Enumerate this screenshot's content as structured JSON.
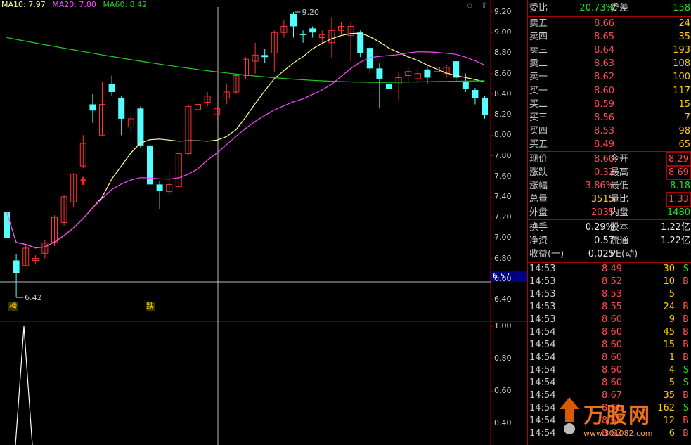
{
  "legend": {
    "ma10": "MA10: 7.97",
    "ma20": "MA20: 7.80",
    "ma60": "MA60: 8.42",
    "colors": {
      "ma10": "#ffff99",
      "ma20": "#ff44ff",
      "ma60": "#22cc22"
    }
  },
  "annotations": {
    "high_label": "9.20",
    "low_label": "6.42",
    "badge_bang": "榜",
    "badge_die": "跌",
    "current_tag": "6.57"
  },
  "price_axis": [
    "9.20",
    "9.00",
    "8.80",
    "8.60",
    "8.40",
    "8.20",
    "8.00",
    "7.80",
    "7.60",
    "7.40",
    "7.20",
    "7.00",
    "6.80",
    "6.60",
    "6.40"
  ],
  "indicator_axis": [
    "1.00",
    "0.80",
    "0.60",
    "0.40"
  ],
  "candles": [
    {
      "o": 7.0,
      "c": 7.25,
      "h": 7.25,
      "l": 7.0,
      "up": false
    },
    {
      "o": 6.78,
      "c": 6.66,
      "h": 6.84,
      "l": 6.42,
      "up": false
    },
    {
      "o": 6.73,
      "c": 6.9,
      "h": 6.93,
      "l": 6.72,
      "up": true
    },
    {
      "o": 6.78,
      "c": 6.8,
      "h": 6.83,
      "l": 6.74,
      "up": true
    },
    {
      "o": 6.85,
      "c": 6.95,
      "h": 6.98,
      "l": 6.8,
      "up": true
    },
    {
      "o": 6.96,
      "c": 7.2,
      "h": 7.22,
      "l": 6.92,
      "up": true
    },
    {
      "o": 7.15,
      "c": 7.4,
      "h": 7.42,
      "l": 7.12,
      "up": true
    },
    {
      "o": 7.35,
      "c": 7.62,
      "h": 7.63,
      "l": 7.3,
      "up": true
    },
    {
      "o": 7.7,
      "c": 7.92,
      "h": 8.0,
      "l": 7.68,
      "up": true
    },
    {
      "o": 8.3,
      "c": 8.24,
      "h": 8.4,
      "l": 8.12,
      "up": false
    },
    {
      "o": 8.0,
      "c": 8.3,
      "h": 8.52,
      "l": 8.0,
      "up": true
    },
    {
      "o": 8.5,
      "c": 8.42,
      "h": 8.58,
      "l": 8.38,
      "up": false
    },
    {
      "o": 8.36,
      "c": 8.16,
      "h": 8.38,
      "l": 8.0,
      "up": false
    },
    {
      "o": 8.16,
      "c": 8.08,
      "h": 8.2,
      "l": 8.02,
      "up": true
    },
    {
      "o": 8.26,
      "c": 7.9,
      "h": 8.28,
      "l": 7.88,
      "up": false
    },
    {
      "o": 7.9,
      "c": 7.52,
      "h": 7.92,
      "l": 7.5,
      "up": false
    },
    {
      "o": 7.52,
      "c": 7.46,
      "h": 7.55,
      "l": 7.28,
      "up": false
    },
    {
      "o": 7.45,
      "c": 7.52,
      "h": 7.65,
      "l": 7.42,
      "up": true
    },
    {
      "o": 7.5,
      "c": 7.82,
      "h": 7.85,
      "l": 7.48,
      "up": true
    },
    {
      "o": 7.82,
      "c": 8.28,
      "h": 8.3,
      "l": 7.8,
      "up": true
    },
    {
      "o": 8.25,
      "c": 8.3,
      "h": 8.35,
      "l": 8.2,
      "up": true
    },
    {
      "o": 8.32,
      "c": 8.38,
      "h": 8.42,
      "l": 8.28,
      "up": true
    },
    {
      "o": 8.2,
      "c": 8.26,
      "h": 8.28,
      "l": 8.14,
      "up": true
    },
    {
      "o": 8.36,
      "c": 8.42,
      "h": 8.5,
      "l": 8.3,
      "up": true
    },
    {
      "o": 8.42,
      "c": 8.58,
      "h": 8.6,
      "l": 8.4,
      "up": true
    },
    {
      "o": 8.58,
      "c": 8.74,
      "h": 8.76,
      "l": 8.55,
      "up": true
    },
    {
      "o": 8.72,
      "c": 8.78,
      "h": 8.9,
      "l": 8.6,
      "up": true
    },
    {
      "o": 8.78,
      "c": 8.76,
      "h": 8.84,
      "l": 8.7,
      "up": false
    },
    {
      "o": 8.8,
      "c": 9.0,
      "h": 9.02,
      "l": 8.62,
      "up": true
    },
    {
      "o": 9.0,
      "c": 9.06,
      "h": 9.12,
      "l": 8.95,
      "up": true
    },
    {
      "o": 9.18,
      "c": 9.06,
      "h": 9.2,
      "l": 8.95,
      "up": false
    },
    {
      "o": 8.98,
      "c": 8.98,
      "h": 9.02,
      "l": 8.9,
      "up": false
    },
    {
      "o": 9.0,
      "c": 9.04,
      "h": 9.06,
      "l": 8.95,
      "up": false
    },
    {
      "o": 8.98,
      "c": 8.95,
      "h": 9.02,
      "l": 8.9,
      "up": true
    },
    {
      "o": 8.9,
      "c": 9.02,
      "h": 9.15,
      "l": 8.75,
      "up": true
    },
    {
      "o": 9.02,
      "c": 9.06,
      "h": 9.1,
      "l": 8.98,
      "up": true
    },
    {
      "o": 9.06,
      "c": 8.97,
      "h": 9.1,
      "l": 8.72,
      "up": true
    },
    {
      "o": 9.0,
      "c": 8.8,
      "h": 9.02,
      "l": 8.76,
      "up": false
    },
    {
      "o": 8.85,
      "c": 8.65,
      "h": 8.86,
      "l": 8.6,
      "up": false
    },
    {
      "o": 8.65,
      "c": 8.55,
      "h": 8.7,
      "l": 8.26,
      "up": false
    },
    {
      "o": 8.5,
      "c": 8.45,
      "h": 8.55,
      "l": 8.24,
      "up": false
    },
    {
      "o": 8.5,
      "c": 8.56,
      "h": 8.62,
      "l": 8.34,
      "up": true
    },
    {
      "o": 8.58,
      "c": 8.62,
      "h": 8.66,
      "l": 8.5,
      "up": true
    },
    {
      "o": 8.55,
      "c": 8.6,
      "h": 8.66,
      "l": 8.5,
      "up": true
    },
    {
      "o": 8.64,
      "c": 8.56,
      "h": 8.67,
      "l": 8.5,
      "up": false
    },
    {
      "o": 8.62,
      "c": 8.66,
      "h": 8.7,
      "l": 8.55,
      "up": true
    },
    {
      "o": 8.66,
      "c": 8.6,
      "h": 8.68,
      "l": 8.56,
      "up": true
    },
    {
      "o": 8.72,
      "c": 8.56,
      "h": 8.72,
      "l": 8.52,
      "up": false
    },
    {
      "o": 8.52,
      "c": 8.45,
      "h": 8.6,
      "l": 8.42,
      "up": false
    },
    {
      "o": 8.44,
      "c": 8.36,
      "h": 8.46,
      "l": 8.3,
      "up": false
    },
    {
      "o": 8.36,
      "c": 8.2,
      "h": 8.38,
      "l": 8.16,
      "up": false
    }
  ],
  "quote": {
    "weibi_label": "委比",
    "weibi_value": "-20.73%",
    "weicha_label": "委差",
    "weicha_value": "-158",
    "asks": [
      {
        "label": "卖五",
        "price": "8.66",
        "vol": "24"
      },
      {
        "label": "卖四",
        "price": "8.65",
        "vol": "35"
      },
      {
        "label": "卖三",
        "price": "8.64",
        "vol": "193"
      },
      {
        "label": "卖二",
        "price": "8.63",
        "vol": "108"
      },
      {
        "label": "卖一",
        "price": "8.62",
        "vol": "100"
      }
    ],
    "bids": [
      {
        "label": "买一",
        "price": "8.60",
        "vol": "117"
      },
      {
        "label": "买二",
        "price": "8.59",
        "vol": "15"
      },
      {
        "label": "买三",
        "price": "8.56",
        "vol": "7"
      },
      {
        "label": "买四",
        "price": "8.53",
        "vol": "98"
      },
      {
        "label": "买五",
        "price": "8.49",
        "vol": "65"
      }
    ],
    "stats": [
      {
        "l": "现价",
        "v": "8.60",
        "vc": "red",
        "l2": "今开",
        "v2": "8.29",
        "v2c": "red"
      },
      {
        "l": "涨跌",
        "v": "0.32",
        "vc": "red",
        "l2": "最高",
        "v2": "8.69",
        "v2c": "red"
      },
      {
        "l": "涨幅",
        "v": "3.86%",
        "vc": "red",
        "l2": "最低",
        "v2": "8.18",
        "v2c": "green"
      },
      {
        "l": "总量",
        "v": "3515",
        "vc": "yellow",
        "l2": "量比",
        "v2": "1.33",
        "v2c": "red"
      },
      {
        "l": "外盘",
        "v": "2035",
        "vc": "red",
        "l2": "内盘",
        "v2": "1480",
        "v2c": "green"
      }
    ],
    "fundamentals": [
      {
        "l": "换手",
        "v": "0.29%",
        "l2": "股本",
        "v2": "1.22亿"
      },
      {
        "l": "净资",
        "v": "0.57",
        "l2": "流通",
        "v2": "1.22亿"
      },
      {
        "l": "收益(一)",
        "v": "-0.025",
        "l2": "PE(动)",
        "v2": "-"
      }
    ],
    "ticks": [
      {
        "t": "14:53",
        "p": "8.49",
        "q": "30",
        "s": "S"
      },
      {
        "t": "14:53",
        "p": "8.52",
        "q": "10",
        "s": "B"
      },
      {
        "t": "14:53",
        "p": "8.53",
        "q": "5",
        "s": ""
      },
      {
        "t": "14:53",
        "p": "8.55",
        "q": "24",
        "s": "B"
      },
      {
        "t": "14:53",
        "p": "8.60",
        "q": "9",
        "s": "B"
      },
      {
        "t": "14:54",
        "p": "8.60",
        "q": "45",
        "s": "B"
      },
      {
        "t": "14:54",
        "p": "8.60",
        "q": "15",
        "s": "B"
      },
      {
        "t": "14:54",
        "p": "8.60",
        "q": "1",
        "s": "B"
      },
      {
        "t": "14:54",
        "p": "8.60",
        "q": "4",
        "s": "S"
      },
      {
        "t": "14:54",
        "p": "8.60",
        "q": "5",
        "s": "S"
      },
      {
        "t": "14:54",
        "p": "8.67",
        "q": "35",
        "s": "B"
      },
      {
        "t": "14:54",
        "p": "8.66",
        "q": "162",
        "s": "S"
      },
      {
        "t": "14:54",
        "p": "8.68",
        "q": "12",
        "s": "B"
      },
      {
        "t": "14:54",
        "p": "8.62",
        "q": "6",
        "s": "B"
      }
    ]
  },
  "watermark": {
    "text": "万股网",
    "url": "www.301082.com"
  }
}
